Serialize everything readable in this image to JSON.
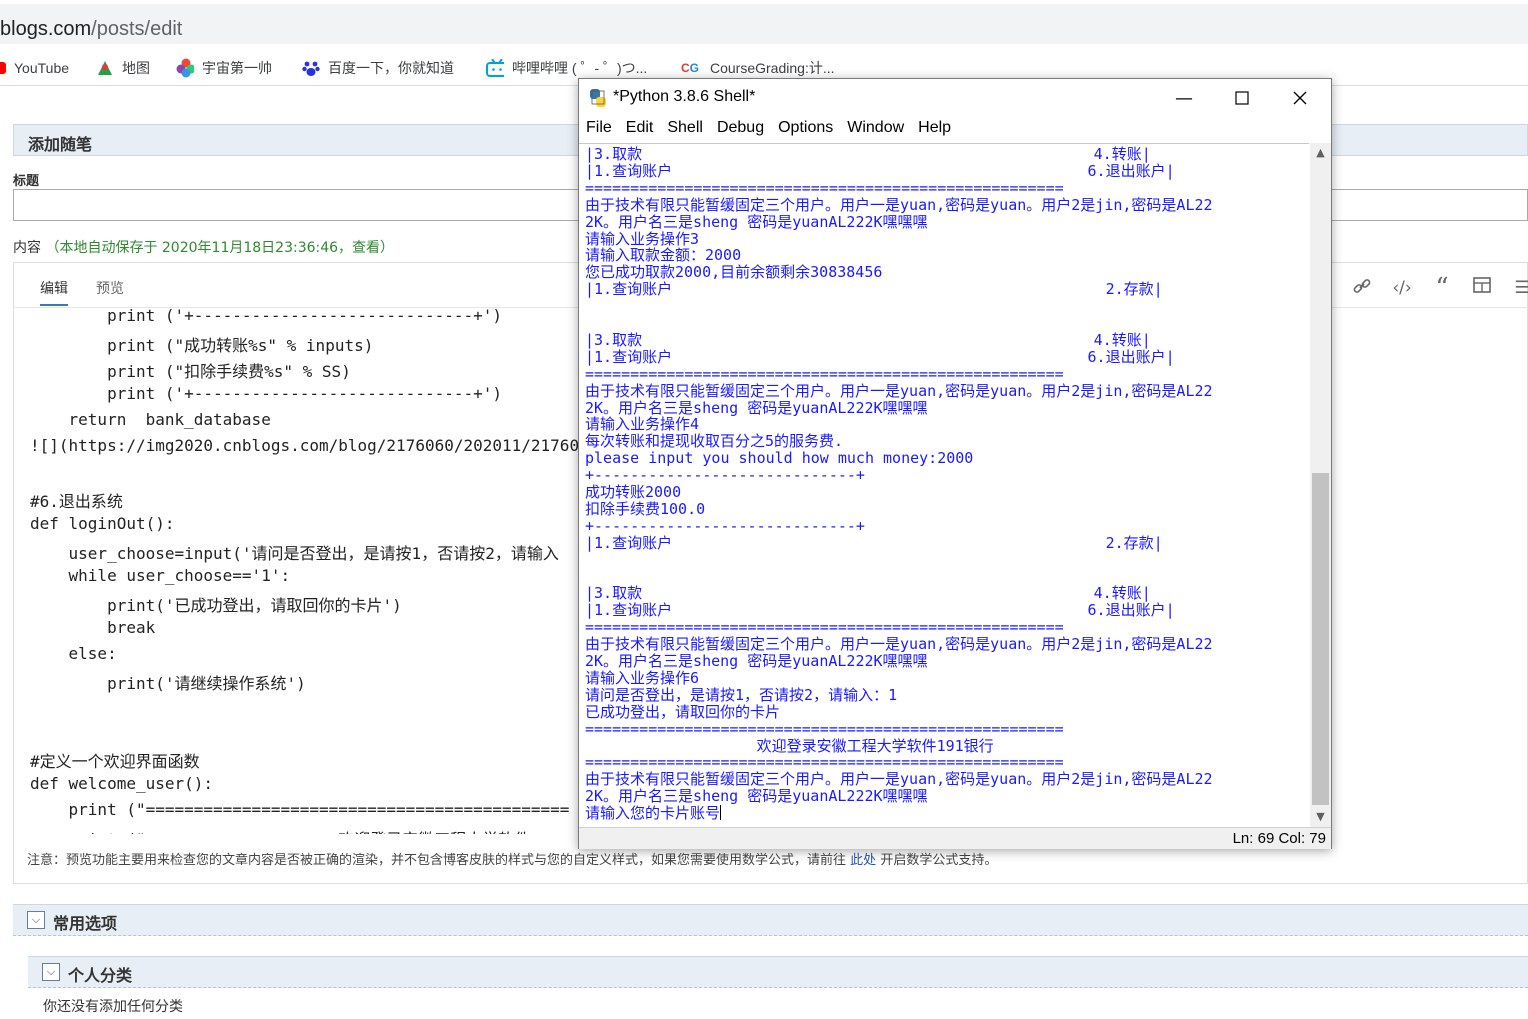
{
  "browser": {
    "url_domain": "blogs.com",
    "url_path": "/posts/edit",
    "bookmarks": [
      {
        "label": "YouTube",
        "icon": "youtube-icon"
      },
      {
        "label": "地图",
        "icon": "map-icon"
      },
      {
        "label": "宇宙第一帅",
        "icon": "flower-icon"
      },
      {
        "label": "百度一下，你就知道",
        "icon": "baidu-paw-icon"
      },
      {
        "label": "哔哩哔哩 ( ゜- ゜)つ...",
        "icon": "bilibili-tv-icon"
      },
      {
        "label": "CourseGrading:计...",
        "icon": "cg-icon"
      }
    ]
  },
  "page": {
    "panel_title": "添加随笔",
    "title_label": "标题",
    "title_value": "",
    "content_label": "内容",
    "autosave_prefix": "（本地自动保存于 2020年11月18日23:36:46，",
    "autosave_link": "查看",
    "autosave_suffix": "）",
    "tab_edit": "编辑",
    "tab_preview": "预览",
    "code_lines": [
      "        print ('+-----------------------------+')",
      "        print (\"成功转账%s\" % inputs)",
      "        print (\"扣除手续费%s\" % SS)",
      "        print ('+-----------------------------+')",
      "    return  bank_database",
      "![](https://img2020.cnblogs.com/blog/2176060/202011/21760",
      "",
      "#6.退出系统",
      "def loginOut():",
      "    user_choose=input('请问是否登出，是请按1，否请按2，请输入",
      "    while user_choose=='1':",
      "        print('已成功登出，请取回你的卡片')",
      "        break",
      "    else:",
      "        print('请继续操作系统')",
      "",
      "",
      "#定义一个欢迎界面函数",
      "def welcome_user():",
      "    print (\"============================================",
      "    print (\"                    欢迎登录安徽工程大学软件"
    ],
    "notice_prefix": "注意：预览功能主要用来检查您的文章内容是否被正确的渲染，并不包含博客皮肤的样式与您的自定义样式，如果您需要使用数学公式，请前往",
    "notice_link": "此处",
    "notice_suffix": "开启数学公式支持。",
    "section_common": "常用选项",
    "section_category": "个人分类",
    "no_category": "你还没有添加任何分类"
  },
  "shell": {
    "title": "*Python 3.8.6 Shell*",
    "menu": [
      "File",
      "Edit",
      "Shell",
      "Debug",
      "Options",
      "Window",
      "Help"
    ],
    "status": "Ln: 69   Col: 79",
    "lines": [
      {
        "t": "|3.取款                                                  4.转账|",
        "c": false
      },
      {
        "t": "|1.查询账户                                              6.退出账户|",
        "c": false
      },
      {
        "t": "=====================================================",
        "c": false
      },
      {
        "t": "由于技术有限只能暂缓固定三个用户。用户一是yuan,密码是yuan。用户2是jin,密码是AL22",
        "c": false
      },
      {
        "t": "2K。用户名三是sheng 密码是yuanAL222K嘿嘿嘿",
        "c": false
      },
      {
        "t": "请输入业务操作3",
        "c": false
      },
      {
        "t": "请输入取款金额：2000",
        "c": false
      },
      {
        "t": "您已成功取款2000,目前余额剩余30838456",
        "c": false
      },
      {
        "t": "|1.查询账户                                                2.存款|",
        "c": false
      },
      {
        "t": "",
        "c": false
      },
      {
        "t": "",
        "c": false
      },
      {
        "t": "|3.取款                                                  4.转账|",
        "c": false
      },
      {
        "t": "|1.查询账户                                              6.退出账户|",
        "c": false
      },
      {
        "t": "=====================================================",
        "c": false
      },
      {
        "t": "由于技术有限只能暂缓固定三个用户。用户一是yuan,密码是yuan。用户2是jin,密码是AL22",
        "c": false
      },
      {
        "t": "2K。用户名三是sheng 密码是yuanAL222K嘿嘿嘿",
        "c": false
      },
      {
        "t": "请输入业务操作4",
        "c": false
      },
      {
        "t": "每次转账和提现收取百分之5的服务费.",
        "c": false
      },
      {
        "t": "please input you should how much money:2000",
        "c": false
      },
      {
        "t": "+-----------------------------+",
        "c": false
      },
      {
        "t": "成功转账2000",
        "c": false
      },
      {
        "t": "扣除手续费100.0",
        "c": false
      },
      {
        "t": "+-----------------------------+",
        "c": false
      },
      {
        "t": "|1.查询账户                                                2.存款|",
        "c": false
      },
      {
        "t": "",
        "c": false
      },
      {
        "t": "",
        "c": false
      },
      {
        "t": "|3.取款                                                  4.转账|",
        "c": false
      },
      {
        "t": "|1.查询账户                                              6.退出账户|",
        "c": false
      },
      {
        "t": "=====================================================",
        "c": false
      },
      {
        "t": "由于技术有限只能暂缓固定三个用户。用户一是yuan,密码是yuan。用户2是jin,密码是AL22",
        "c": false
      },
      {
        "t": "2K。用户名三是sheng 密码是yuanAL222K嘿嘿嘿",
        "c": false
      },
      {
        "t": "请输入业务操作6",
        "c": false
      },
      {
        "t": "请问是否登出，是请按1，否请按2，请输入：1",
        "c": false
      },
      {
        "t": "已成功登出，请取回你的卡片",
        "c": false
      },
      {
        "t": "=====================================================",
        "c": false
      },
      {
        "t": "                   欢迎登录安徽工程大学软件191银行",
        "c": false
      },
      {
        "t": "=====================================================",
        "c": false
      },
      {
        "t": "由于技术有限只能暂缓固定三个用户。用户一是yuan,密码是yuan。用户2是jin,密码是AL22",
        "c": false
      },
      {
        "t": "2K。用户名三是sheng 密码是yuanAL222K嘿嘿嘿",
        "c": false
      },
      {
        "t": "请输入您的卡片账号",
        "c": false
      }
    ]
  },
  "colors": {
    "shell_output": "#1a1aff",
    "autosave_green": "#2f8a2f",
    "section_bg": "#e7eef5"
  }
}
